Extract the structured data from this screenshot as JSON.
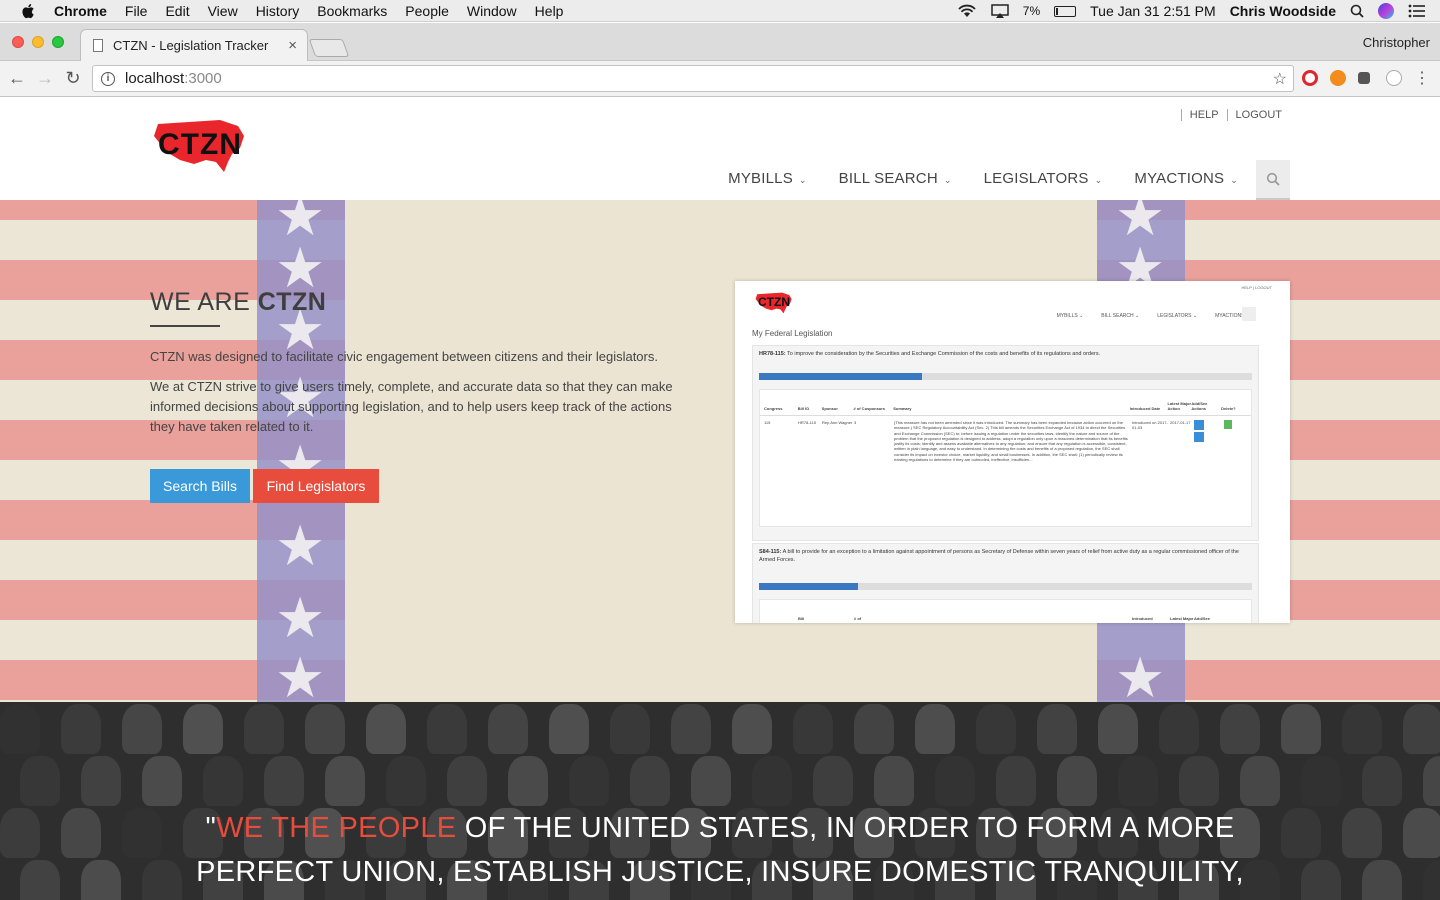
{
  "mac_menubar": {
    "app": "Chrome",
    "menus": [
      "File",
      "Edit",
      "View",
      "History",
      "Bookmarks",
      "People",
      "Window",
      "Help"
    ],
    "battery": "7%",
    "clock": "Tue Jan 31  2:51 PM",
    "user": "Chris Woodside"
  },
  "browser": {
    "tab_title": "CTZN - Legislation Tracker",
    "tab_close": "×",
    "profile": "Christopher",
    "url_host": "localhost",
    "url_port": ":3000"
  },
  "site": {
    "logo_text": "CTZN",
    "util_links": [
      "HELP",
      "LOGOUT"
    ],
    "nav": [
      "MYBILLS",
      "BILL SEARCH",
      "LEGISLATORS",
      "MYACTIONS"
    ]
  },
  "hero": {
    "title_prefix": "WE ARE ",
    "title_bold": "CTZN",
    "paragraph_1": "CTZN was designed to facilitate civic engagement between citizens and their legislators.",
    "paragraph_2": "We at CTZN strive to give users timely, complete, and accurate data so that they can make informed decisions about supporting legislation, and to help users keep track of the actions they have taken related to it.",
    "search_bills_btn": "Search Bills",
    "find_legislators_btn": "Find Legislators"
  },
  "preview": {
    "util": "HELP  |  LOGOUT",
    "nav": [
      "MYBILLS ⌄",
      "BILL SEARCH ⌄",
      "LEGISLATORS ⌄",
      "MYACTIONS ⌄"
    ],
    "heading": "My Federal Legislation",
    "bill1_id": "HR78-115:",
    "bill1_title": "To improve the consideration by the Securities and Exchange Commission of the costs and benefits of its regulations and orders.",
    "bill1_progress": 0.33,
    "columns": [
      "Congress",
      "Bill ID",
      "Sponsor",
      "# of Cosponsors",
      "Summary",
      "Introduced Date",
      "Latest Major Action",
      "Add/See Actions",
      "Delete?"
    ],
    "row": {
      "congress": "115",
      "bill_id": "HR78-115",
      "sponsor": "Rep Ann Wagner",
      "cosponsors": "3",
      "summary": "(This measure has not been amended since it was introduced. The summary has been expanded because action occurred on the measure.) SEC Regulatory Accountability Act (Sec. 2) This bill amends the Securities Exchange Act of 1934 to direct the Securities and Exchange Commission (SEC) to: before issuing a regulation under the securities laws, identify the nature and source of the problem that the proposed regulation is designed to address; adopt a regulation only upon a reasoned determination that its benefits justify its costs; identify and assess available alternatives to any regulation; and ensure that any regulation is accessible, consistent, written in plain language, and easy to understand. In determining the costs and benefits of a proposed regulation, the SEC shall consider its impact on investor choice, market liquidity, and small businesses. In addition, the SEC shall: (1) periodically review its existing regulations to determine if they are outmoded, ineffective, insufficien...",
      "introduced": "Introduced on 2017-01-03",
      "latest": "2017-01-17"
    },
    "bill2_id": "S84-115:",
    "bill2_title": "A bill to provide for an exception to a limitation against appointment of persons as Secretary of Defense within seven years of relief from active duty as a regular commissioned officer of the Armed Forces.",
    "bill2_progress": 0.2,
    "columns2": [
      "Bill",
      "# of",
      "Introduced",
      "Latest Major",
      "Add/See"
    ]
  },
  "quote": {
    "open": "\"",
    "highlight": "WE THE PEOPLE",
    "line1_rest": " OF THE UNITED STATES, IN ORDER TO FORM A MORE",
    "line2": "PERFECT UNION, ESTABLISH JUSTICE, INSURE DOMESTIC TRANQUILITY,"
  },
  "colors": {
    "brand_red": "#e74c3c",
    "brand_blue": "#3a99d8"
  }
}
